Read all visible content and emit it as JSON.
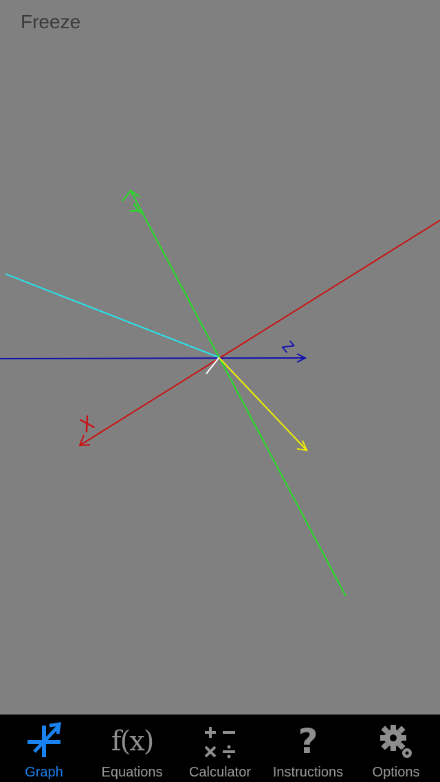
{
  "toolbar": {
    "freeze_label": "Freeze"
  },
  "graph": {
    "axis_labels": {
      "x": "X",
      "y": "Y",
      "z": "Z"
    },
    "colors": {
      "background": "#808080",
      "x_axis": "#cc1010",
      "y_axis": "#22e022",
      "z_axis": "#1010b0",
      "cyan_line": "#22e8f0",
      "yellow_line": "#f0f000",
      "white_line": "#ffffff"
    }
  },
  "tab_bar": {
    "active_color": "#1a82f0",
    "inactive_color": "#9a9a9a",
    "tabs": [
      {
        "label": "Graph",
        "icon": "graph-icon",
        "active": true
      },
      {
        "label": "Equations",
        "icon": "function-icon",
        "active": false
      },
      {
        "label": "Calculator",
        "icon": "calculator-icon",
        "active": false
      },
      {
        "label": "Instructions",
        "icon": "question-icon",
        "active": false
      },
      {
        "label": "Options",
        "icon": "gear-icon",
        "active": false
      }
    ]
  }
}
